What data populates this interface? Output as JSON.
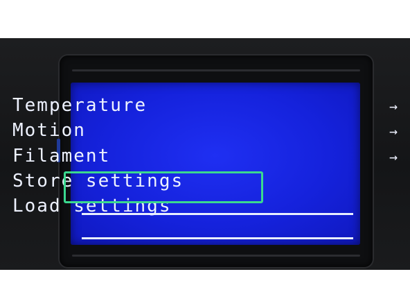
{
  "menu": {
    "items": [
      {
        "label": "Temperature",
        "arrow": "→"
      },
      {
        "label": "Motion",
        "arrow": "→"
      },
      {
        "label": "Filament",
        "arrow": "→"
      },
      {
        "label": "Store settings",
        "arrow": ""
      },
      {
        "label": "Load settings",
        "arrow": ""
      }
    ],
    "selected_index": 3
  },
  "colors": {
    "screen_background": "#1522dc",
    "text": "#eef2ff",
    "highlight_outline": "#3bd98f",
    "bezel": "#0e0f11"
  }
}
